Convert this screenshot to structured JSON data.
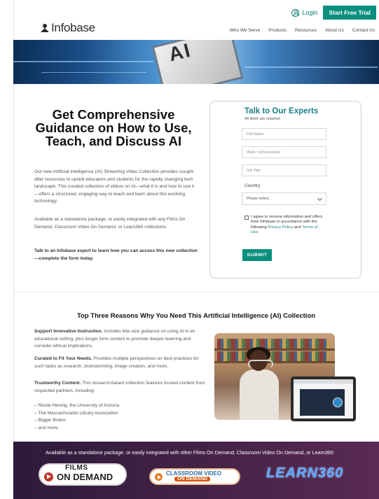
{
  "header": {
    "login_label": "Login",
    "trial_label": "Start Free Trial",
    "logo_text": "Infobase",
    "nav": [
      "Who We Serve",
      "Products",
      "Resources",
      "About Us",
      "Contact Us"
    ]
  },
  "hero": {
    "chip_text": "AI"
  },
  "main": {
    "headline": "Get Comprehensive Guidance on How to Use, Teach, and Discuss AI",
    "paragraphs": [
      "Our new Artificial Intelligence (AI) Streaming Video Collection provides sought-after resources to upskill educators and students for the rapidly changing tech landscape. This curated collection of videos on AI—what it is and how to use it—offers a structured, engaging way to teach and learn about this evolving technology.",
      "Available as a standalone package, or easily integrated with any Films On Demand, Classroom Video On Demand, or Learn360 collections.",
      "Talk to an Infobase expert to learn how you can access this new collection—complete the form today."
    ]
  },
  "form": {
    "title": "Talk to Our Experts",
    "required_note": "All fields are required",
    "fields": [
      "Full Name",
      "Work / School Email",
      "Job Title"
    ],
    "country_label": "Country",
    "country_selected": "Please select...",
    "consent_text": "I agree to receive information and offers from Infobase in accordance with the following",
    "privacy_link": "Privacy Policy",
    "and_text": "and",
    "terms_link": "Terms of Use.",
    "submit_label": "SUBMIT"
  },
  "reasons": {
    "title": "Top Three Reasons Why You Need This Artificial Intelligence (AI) Collection",
    "items": [
      {
        "heading": "Support Innovative Instruction.",
        "body": "Includes bite-size guidance on using AI in an educational setting, plus longer form content to promote deeper learning and consider ethical implications."
      },
      {
        "heading": "Curated to Fit Your Needs.",
        "body": "Provides multiple perspectives on best practices for such tasks as research, brainstorming, image creation, and more."
      },
      {
        "heading": "Trustworthy Content.",
        "body": "This research-based collection features trusted content from respected partners, including:"
      }
    ],
    "partners": [
      "– Nicole Hennig, the University of Arizona",
      "– The Massachusetts Library Association",
      "– Bigger Brains",
      "– and more."
    ]
  },
  "footer": {
    "text": "Available as a standalone package, or easily integrated with other Films On Demand, Classroom Video On Demand, or Learn360",
    "films_line1": "FILMS",
    "films_line2": "ON DEMAND",
    "cvod_line1": "CLASSROOM VIDEO",
    "cvod_line2": "ON DEMAND",
    "learn_text": "LEARN360"
  },
  "colors": {
    "accent": "#0a8f7e",
    "form_title": "#1b7f86",
    "footer_bg": "#4a2346"
  }
}
